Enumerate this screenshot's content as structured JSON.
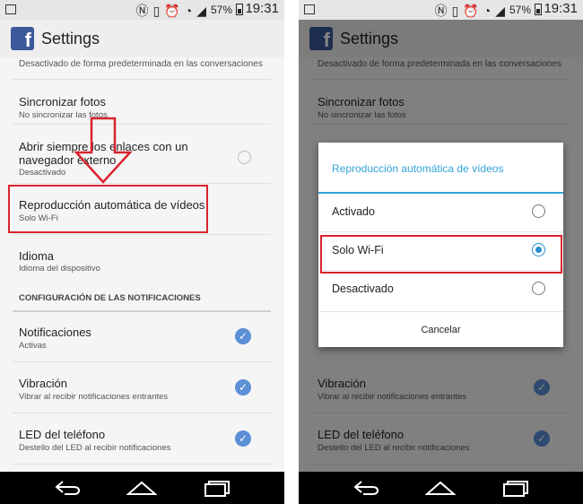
{
  "status_bar": {
    "battery": "57%",
    "time": "19:31",
    "icons": [
      "gallery-icon",
      "nfc-icon",
      "vibrate-icon",
      "alarm-icon",
      "wifi-icon",
      "no-signal-icon",
      "battery-icon"
    ]
  },
  "app_bar": {
    "title": "Settings",
    "logo": "facebook-logo"
  },
  "settings": {
    "prev_subtitle": "Desactivado de forma predeterminada en las conversaciones",
    "items": [
      {
        "title": "Sincronizar fotos",
        "subtitle": "No sincronizar las fotos"
      },
      {
        "title": "Abrir siempre los enlaces con un navegador externo",
        "subtitle": "Desactivado"
      },
      {
        "title": "Reproducción automática de vídeos",
        "subtitle": "Solo Wi-Fi"
      },
      {
        "title": "Idioma",
        "subtitle": "Idioma del dispositivo"
      }
    ],
    "section_header": "CONFIGURACIÓN DE LAS NOTIFICACIONES",
    "notification_items": [
      {
        "title": "Notificaciones",
        "subtitle": "Activas",
        "checked": true
      },
      {
        "title": "Vibración",
        "subtitle": "Vibrar al recibir notificaciones entrantes",
        "checked": true
      },
      {
        "title": "LED del teléfono",
        "subtitle": "Destello del LED al recibir notificaciones",
        "checked": true
      }
    ]
  },
  "dialog": {
    "title": "Reproducción automática de vídeos",
    "options": [
      {
        "label": "Activado",
        "selected": false
      },
      {
        "label": "Solo Wi-Fi",
        "selected": true
      },
      {
        "label": "Desactivado",
        "selected": false
      }
    ],
    "cancel": "Cancelar"
  },
  "colors": {
    "facebook": "#3b5998",
    "accent": "#33a3dc",
    "check": "#5b8fd6",
    "annotation": "#d9232e"
  },
  "nav_icons": [
    "back-icon",
    "home-icon",
    "recents-icon"
  ]
}
